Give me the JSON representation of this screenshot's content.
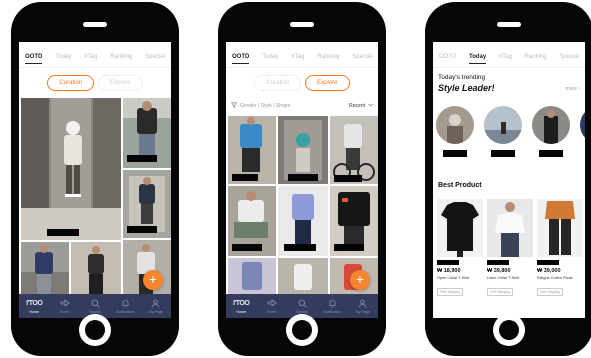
{
  "colors": {
    "accent": "#f07a2c",
    "fab": "#f5852f",
    "nav_bg": "#343c5e",
    "phone_body": "#060606"
  },
  "top_tabs": {
    "phone1": [
      {
        "label": "OOTD",
        "active": true
      },
      {
        "label": "Today",
        "active": false
      },
      {
        "label": "#Tag",
        "active": false
      },
      {
        "label": "Ranking",
        "active": false
      },
      {
        "label": "Special",
        "active": false
      }
    ],
    "phone2": [
      {
        "label": "OOTD",
        "active": true
      },
      {
        "label": "Today",
        "active": false
      },
      {
        "label": "#Tag",
        "active": false
      },
      {
        "label": "Ranking",
        "active": false
      },
      {
        "label": "Special",
        "active": false
      }
    ],
    "phone3": [
      {
        "label": "OOTD",
        "active": false
      },
      {
        "label": "Today",
        "active": true
      },
      {
        "label": "#Tag",
        "active": false
      },
      {
        "label": "Ranking",
        "active": false
      },
      {
        "label": "Special",
        "active": false
      }
    ]
  },
  "feed_toggle": {
    "curation_label": "Curation",
    "explore_label": "Explore"
  },
  "explore_filter": {
    "filter_text": "Gender | Style | Shape",
    "sort_label": "Recent"
  },
  "fab_label": "+",
  "bottom_nav": {
    "logo_text": "I'TOO",
    "items": [
      {
        "label": "Home",
        "icon": "logo-mark"
      },
      {
        "label": "Event",
        "icon": "arrow-right-icon"
      },
      {
        "label": "Search",
        "icon": "search-icon"
      },
      {
        "label": "Notification",
        "icon": "bell-icon"
      },
      {
        "label": "My Page",
        "icon": "person-icon"
      }
    ]
  },
  "today": {
    "trending_small": "Today's trending",
    "trending_big": "Style Leader!",
    "more_label": "more",
    "best_title": "Best Product",
    "products": [
      {
        "price": "₩ 18,900",
        "name": "Open Collar T-Shirt",
        "badge": "Free Shipping"
      },
      {
        "price": "₩ 39,800",
        "name": "Linen Collar T-Shirt",
        "badge": "Free Shipping"
      },
      {
        "price": "₩ 39,000",
        "name": "Fatigue Cotton Pants",
        "badge": "Free Shipping"
      }
    ]
  }
}
